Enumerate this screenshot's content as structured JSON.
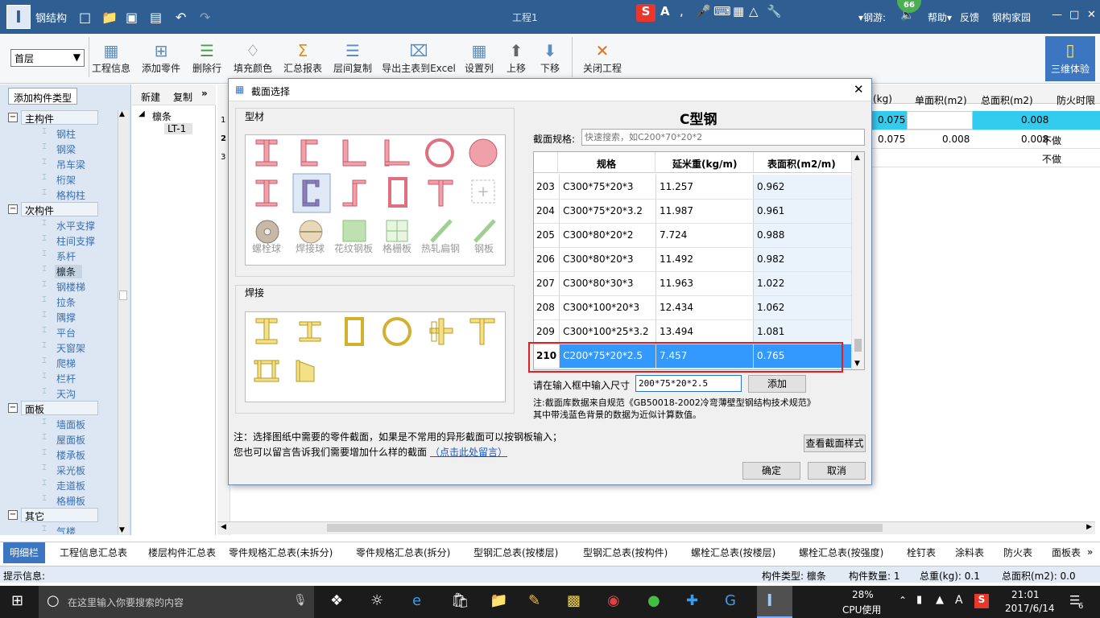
{
  "app": {
    "title": "钢结构",
    "document": "工程1",
    "ime_badge": "66",
    "right_menu": [
      "钢游:",
      "帮助",
      "反馈",
      "钢构家园"
    ]
  },
  "ribbon": {
    "floor_select": "首层",
    "buttons": [
      "工程信息",
      "添加零件",
      "删除行",
      "填充颜色",
      "汇总报表",
      "层间复制",
      "导出主表到Excel",
      "设置列",
      "上移",
      "下移",
      "关闭工程"
    ],
    "threed": "三维体验"
  },
  "left": {
    "add_type_button": "添加构件类型",
    "categories": [
      {
        "name": "主构件",
        "items": [
          "钢柱",
          "钢梁",
          "吊车梁",
          "桁架",
          "格构柱"
        ]
      },
      {
        "name": "次构件",
        "items": [
          "水平支撑",
          "柱间支撑",
          "系杆",
          "檩条",
          "钢楼梯",
          "拉条",
          "隅撑",
          "平台",
          "天窗架",
          "爬梯",
          "栏杆",
          "天沟"
        ]
      },
      {
        "name": "面板",
        "items": [
          "墙面板",
          "屋面板",
          "楼承板",
          "采光板",
          "走道板",
          "格栅板"
        ]
      },
      {
        "name": "其它",
        "items": [
          "气楼"
        ]
      }
    ],
    "selected_item": "檩条"
  },
  "mid": {
    "new_label": "新建",
    "copy_label": "复制",
    "more": "»",
    "tree_root": "檩条",
    "tree_child": "LT-1"
  },
  "grid": {
    "headers": [
      "(kg)",
      "单面积(m2)",
      "总面积(m2)",
      "防火时限"
    ],
    "rows": [
      {
        "num": "1",
        "kg": "0.075",
        "single": "",
        "total": "0.008",
        "fire": ""
      },
      {
        "num": "2",
        "kg": "0.075",
        "single": "0.008",
        "total": "0.008",
        "fire": "不做"
      },
      {
        "num": "3",
        "kg": "",
        "single": "",
        "total": "",
        "fire": "不做"
      }
    ]
  },
  "dialog": {
    "title": "截面选择",
    "type_group": "型材",
    "weld_group": "焊接",
    "section_title": "C型钢",
    "spec_label": "截面规格:",
    "search_placeholder": "快速搜索，如C200*70*20*2",
    "columns": [
      "规格",
      "延米重(kg/m)",
      "表面积(m2/m)"
    ],
    "rows": [
      {
        "num": "203",
        "spec": "C300*75*20*3",
        "weight": "11.257",
        "area": "0.962"
      },
      {
        "num": "204",
        "spec": "C300*75*20*3.2",
        "weight": "11.987",
        "area": "0.961"
      },
      {
        "num": "205",
        "spec": "C300*80*20*2",
        "weight": "7.724",
        "area": "0.988"
      },
      {
        "num": "206",
        "spec": "C300*80*20*3",
        "weight": "11.492",
        "area": "0.982"
      },
      {
        "num": "207",
        "spec": "C300*80*30*3",
        "weight": "11.963",
        "area": "1.022"
      },
      {
        "num": "208",
        "spec": "C300*100*20*3",
        "weight": "12.434",
        "area": "1.062"
      },
      {
        "num": "209",
        "spec": "C300*100*25*3.2",
        "weight": "13.494",
        "area": "1.081"
      },
      {
        "num": "210",
        "spec": "C200*75*20*2.5",
        "weight": "7.457",
        "area": "0.765"
      }
    ],
    "input_label": "请在输入框中输入尺寸",
    "input_value": "200*75*20*2.5",
    "add_button": "添加",
    "note1": "注:截面库数据来自规范《GB50018-2002冷弯薄壁型钢结构技术规范》",
    "note2": "其中带浅蓝色背景的数据为近似计算数值。",
    "footer_note1": "注：选择图纸中需要的零件截面，如果是不常用的异形截面可以按钢板输入；",
    "footer_note2": "您也可以留言告诉我们需要增加什么样的截面",
    "footer_link": "（点击此处留言）",
    "view_style_button": "查看截面样式",
    "ok_button": "确定",
    "cancel_button": "取消",
    "shape_labels": [
      "螺栓球",
      "焊接球",
      "花纹钢板",
      "格栅板",
      "热轧扁钢",
      "钢板"
    ]
  },
  "bottom_tabs": [
    "明细栏",
    "工程信息汇总表",
    "楼层构件汇总表",
    "零件规格汇总表(未拆分)",
    "零件规格汇总表(拆分)",
    "型钢汇总表(按楼层)",
    "型钢汇总表(按构件)",
    "螺栓汇总表(按楼层)",
    "螺栓汇总表(按强度)",
    "栓钉表",
    "涂料表",
    "防火表",
    "面板表"
  ],
  "status": {
    "hint": "提示信息:",
    "type": "构件类型: 檩条",
    "count": "构件数量: 1",
    "weight": "总重(kg): 0.1",
    "area": "总面积(m2): 0.0"
  },
  "taskbar": {
    "search": "在这里输入你要搜索的内容",
    "cpu_pct": "28%",
    "cpu_label": "CPU使用",
    "ime": "A",
    "time": "21:01",
    "date": "2017/6/14",
    "notif": "6"
  },
  "colors": {
    "accent": "#3d76c0",
    "title": "#2f5f92",
    "highlight_row": "#3399ff",
    "red_box": "#e02020"
  }
}
